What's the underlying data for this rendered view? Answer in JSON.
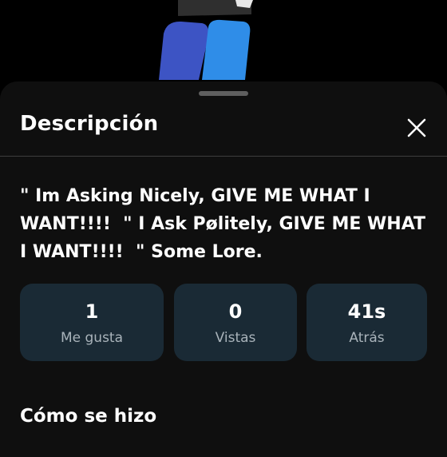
{
  "sheet": {
    "title": "Descripción",
    "close_icon": "close-icon"
  },
  "description": {
    "text": "\" Im Asking Nicely, GIVE ME WHAT I WANT!!!!  \" I Ask Pølitely, GIVE ME WHAT I WANT!!!!  \" Some Lore."
  },
  "stats": [
    {
      "value": "1",
      "label": "Me gusta"
    },
    {
      "value": "0",
      "label": "Vistas"
    },
    {
      "value": "41s",
      "label": "Atrás"
    }
  ],
  "section": {
    "title": "Cómo se hizo"
  },
  "colors": {
    "sheet_bg": "#0f0f0f",
    "stat_card_bg": "#1a2a35",
    "stat_label": "#a9b3ba",
    "divider": "#3d3d3d"
  }
}
